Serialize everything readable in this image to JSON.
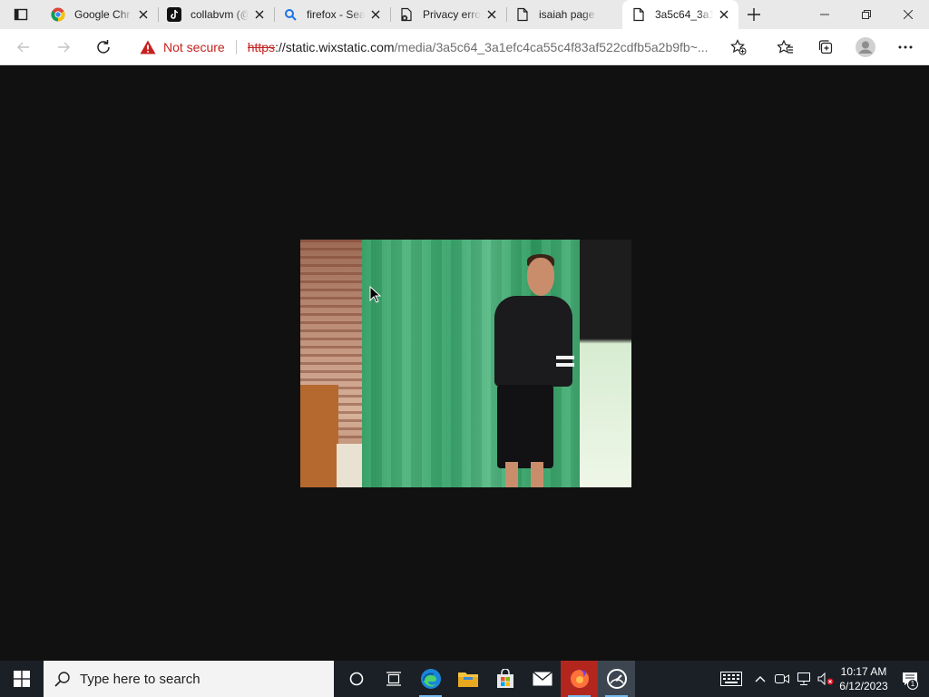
{
  "browser": {
    "tabs": [
      {
        "title": "Google Chr",
        "icon": "chrome-icon",
        "active": false
      },
      {
        "title": "collabvm (@",
        "icon": "tiktok-icon",
        "active": false
      },
      {
        "title": "firefox - Sea",
        "icon": "search-icon",
        "active": false
      },
      {
        "title": "Privacy erro",
        "icon": "page-error-icon",
        "active": false
      },
      {
        "title": "isaiah page",
        "icon": "page-icon",
        "active": false
      },
      {
        "title": "3a5c64_3a1",
        "icon": "page-icon",
        "active": true
      }
    ],
    "security_label": "Not secure",
    "url": {
      "scheme": "https",
      "host": "://static.wixstatic.com",
      "path": "/media/3a5c64_3a1efc4ca55c4f83af522cdfb5a2b9fb~..."
    }
  },
  "taskbar": {
    "search_placeholder": "Type here to search",
    "time": "10:17 AM",
    "date": "6/12/2023",
    "notification_count": "1"
  },
  "colors": {
    "page_background": "#111111",
    "taskbar": "#1b2027",
    "not_secure": "#c5221f"
  }
}
